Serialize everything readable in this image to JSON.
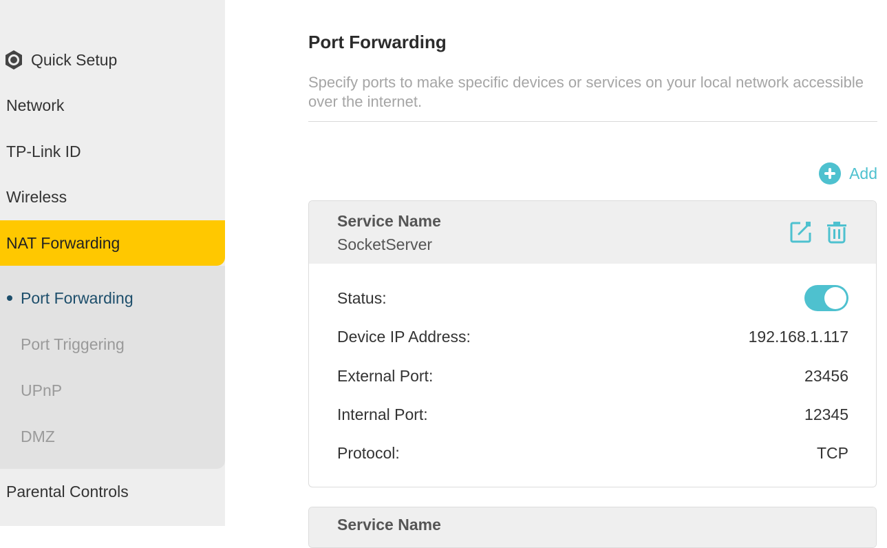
{
  "sidebar": {
    "items": [
      {
        "label": "Quick Setup",
        "icon": "gear-icon"
      },
      {
        "label": "Network"
      },
      {
        "label": "TP-Link ID"
      },
      {
        "label": "Wireless"
      },
      {
        "label": "NAT Forwarding"
      },
      {
        "label": "Parental Controls"
      }
    ],
    "subitems": [
      {
        "label": "Port Forwarding"
      },
      {
        "label": "Port Triggering"
      },
      {
        "label": "UPnP"
      },
      {
        "label": "DMZ"
      }
    ]
  },
  "main": {
    "title": "Port Forwarding",
    "description": "Specify ports to make specific devices or services on your local network accessible over the internet.",
    "add_label": "Add",
    "entries": [
      {
        "service_label": "Service Name",
        "service_name": "SocketServer",
        "status_label": "Status:",
        "status_on": true,
        "ip_label": "Device IP Address:",
        "ip": "192.168.1.117",
        "ext_label": "External Port:",
        "ext_port": "23456",
        "int_label": "Internal Port:",
        "int_port": "12345",
        "proto_label": "Protocol:",
        "protocol": "TCP"
      },
      {
        "service_label": "Service Name"
      }
    ]
  },
  "colors": {
    "accent": "#4ec1cf",
    "active_nav": "#ffc800"
  }
}
